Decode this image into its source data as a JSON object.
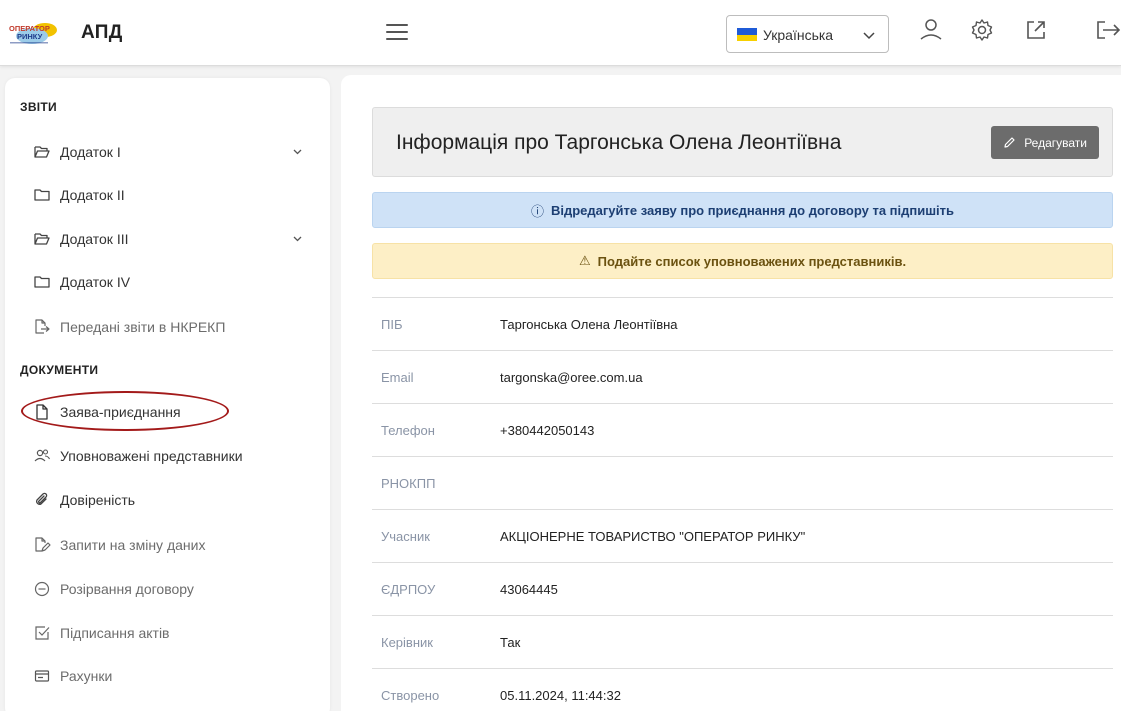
{
  "header": {
    "logo_text": [
      "ОПЕРАТОР",
      "РИНКУ"
    ],
    "app_title": "АПД",
    "language": {
      "selected": "Українська",
      "flag_colors": [
        "#1f5bd7",
        "#f7d000"
      ]
    },
    "icons": [
      "menu-icon",
      "user-icon",
      "gear-icon",
      "external-link-icon",
      "logout-icon"
    ]
  },
  "sidebar": {
    "reports_title": "ЗВІТИ",
    "reports": [
      {
        "label": "Додаток I",
        "icon": "folder-open-icon",
        "expandable": true
      },
      {
        "label": "Додаток II",
        "icon": "folder-icon",
        "expandable": false
      },
      {
        "label": "Додаток III",
        "icon": "folder-open-icon",
        "expandable": true
      },
      {
        "label": "Додаток IV",
        "icon": "folder-icon",
        "expandable": false
      },
      {
        "label": "Передані звіти в НКРЕКП",
        "icon": "file-export-icon",
        "expandable": false
      }
    ],
    "documents_title": "ДОКУМЕНТИ",
    "documents": [
      {
        "label": "Заява-приєднання",
        "icon": "file-icon"
      },
      {
        "label": "Уповноважені представники",
        "icon": "users-icon"
      },
      {
        "label": "Довіреність",
        "icon": "paperclip-icon"
      },
      {
        "label": "Запити на зміну даних",
        "icon": "file-edit-icon"
      },
      {
        "label": "Розірвання договору",
        "icon": "minus-circle-icon"
      },
      {
        "label": "Підписання актів",
        "icon": "check-square-icon"
      },
      {
        "label": "Рахунки",
        "icon": "invoice-icon"
      }
    ],
    "highlight_color": "#a31a1a"
  },
  "main": {
    "title": "Інформація про Таргонська Олена Леонтіївна",
    "edit_label": "Редагувати",
    "info_alert": "Відредагуйте заяву про приєднання до договору та підпишіть",
    "warning_alert": "Подайте список уповноважених представників.",
    "fields": [
      {
        "label": "ПІБ",
        "value": "Таргонська Олена Леонтіївна"
      },
      {
        "label": "Email",
        "value": "targonska@oree.com.ua"
      },
      {
        "label": "Телефон",
        "value": "+380442050143"
      },
      {
        "label": "РНОКПП",
        "value": ""
      },
      {
        "label": "Учасник",
        "value": "АКЦІОНЕРНЕ ТОВАРИСТВО \"ОПЕРАТОР РИНКУ\""
      },
      {
        "label": "ЄДРПОУ",
        "value": "43064445"
      },
      {
        "label": "Керівник",
        "value": "Так"
      },
      {
        "label": "Створено",
        "value": "05.11.2024, 11:44:32"
      }
    ]
  }
}
